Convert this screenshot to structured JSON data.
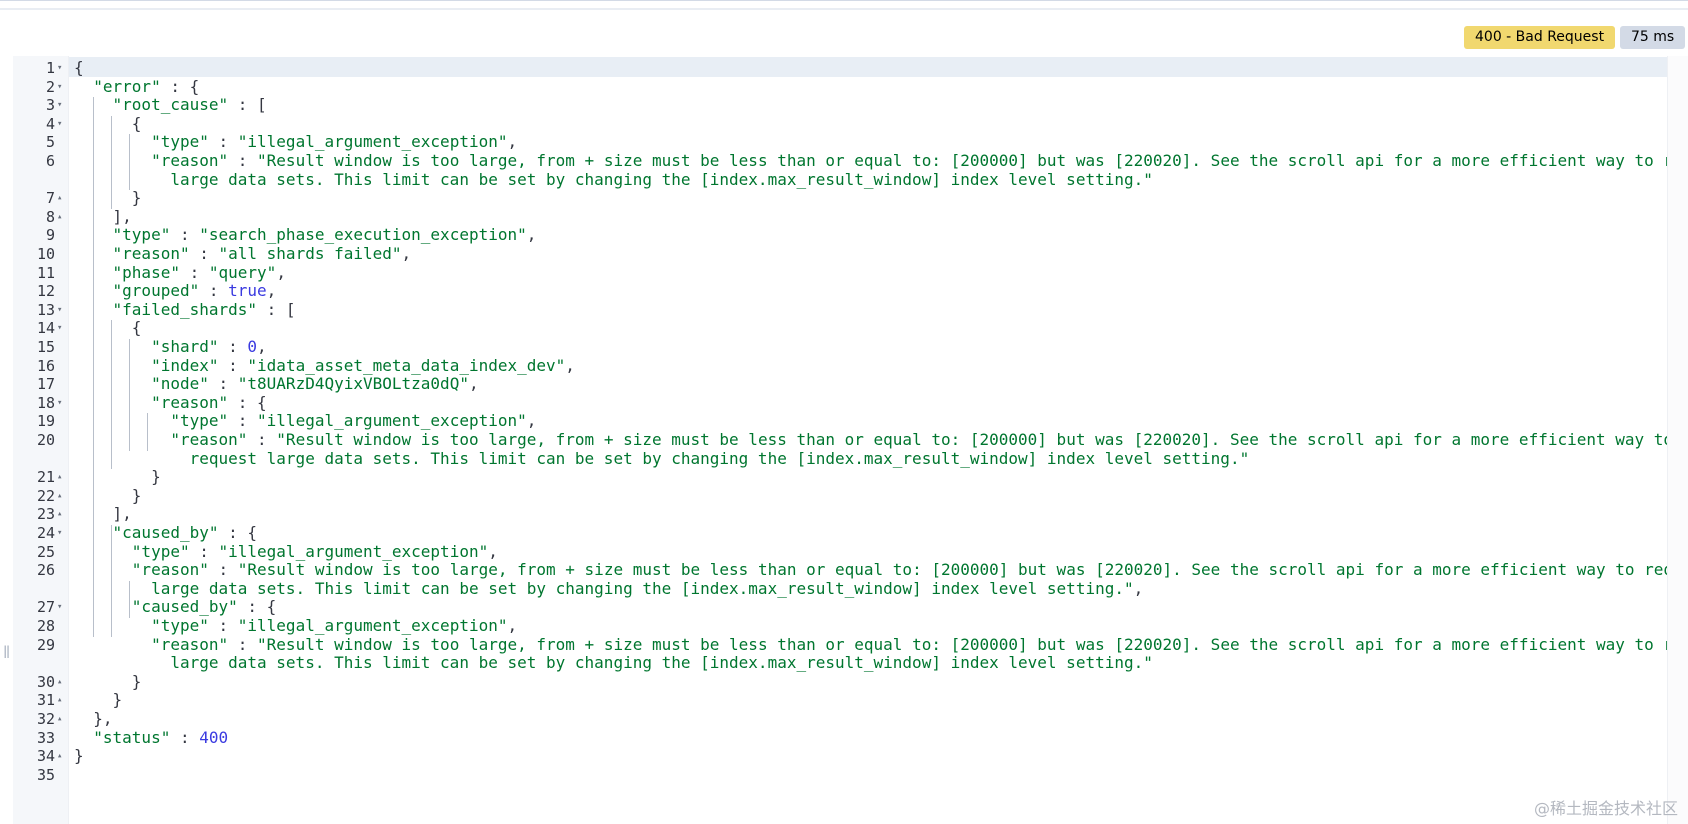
{
  "response": {
    "status_badge": "400 - Bad Request",
    "time_badge": "75 ms"
  },
  "editor": {
    "lines": [
      {
        "n": "1",
        "fold": "▾",
        "segments": [
          {
            "t": "{",
            "c": "punct"
          }
        ]
      },
      {
        "n": "2",
        "fold": "▾",
        "segments": [
          {
            "t": "  ",
            "c": "punct"
          },
          {
            "t": "\"error\"",
            "c": "key"
          },
          {
            "t": " : {",
            "c": "punct"
          }
        ]
      },
      {
        "n": "3",
        "fold": "▾",
        "segments": [
          {
            "t": "    ",
            "c": "punct"
          },
          {
            "t": "\"root_cause\"",
            "c": "key"
          },
          {
            "t": " : [",
            "c": "punct"
          }
        ]
      },
      {
        "n": "4",
        "fold": "▾",
        "segments": [
          {
            "t": "      {",
            "c": "punct"
          }
        ]
      },
      {
        "n": "5",
        "fold": "",
        "segments": [
          {
            "t": "        ",
            "c": "punct"
          },
          {
            "t": "\"type\"",
            "c": "key"
          },
          {
            "t": " : ",
            "c": "punct"
          },
          {
            "t": "\"illegal_argument_exception\"",
            "c": "str"
          },
          {
            "t": ",",
            "c": "punct"
          }
        ]
      },
      {
        "n": "6",
        "fold": "",
        "segments": [
          {
            "t": "        ",
            "c": "punct"
          },
          {
            "t": "\"reason\"",
            "c": "key"
          },
          {
            "t": " : ",
            "c": "punct"
          },
          {
            "t": "\"Result window is too large, from + size must be less than or equal to: [200000] but was [220020]. See the scroll api for a more efficient way to request",
            "c": "str"
          }
        ]
      },
      {
        "n": "",
        "fold": "",
        "segments": [
          {
            "t": "          ",
            "c": "punct"
          },
          {
            "t": "large data sets. This limit can be set by changing the [index.max_result_window] index level setting.\"",
            "c": "str"
          }
        ]
      },
      {
        "n": "7",
        "fold": "▴",
        "segments": [
          {
            "t": "      }",
            "c": "punct"
          }
        ]
      },
      {
        "n": "8",
        "fold": "▴",
        "segments": [
          {
            "t": "    ],",
            "c": "punct"
          }
        ]
      },
      {
        "n": "9",
        "fold": "",
        "segments": [
          {
            "t": "    ",
            "c": "punct"
          },
          {
            "t": "\"type\"",
            "c": "key"
          },
          {
            "t": " : ",
            "c": "punct"
          },
          {
            "t": "\"search_phase_execution_exception\"",
            "c": "str"
          },
          {
            "t": ",",
            "c": "punct"
          }
        ]
      },
      {
        "n": "10",
        "fold": "",
        "segments": [
          {
            "t": "    ",
            "c": "punct"
          },
          {
            "t": "\"reason\"",
            "c": "key"
          },
          {
            "t": " : ",
            "c": "punct"
          },
          {
            "t": "\"all shards failed\"",
            "c": "str"
          },
          {
            "t": ",",
            "c": "punct"
          }
        ]
      },
      {
        "n": "11",
        "fold": "",
        "segments": [
          {
            "t": "    ",
            "c": "punct"
          },
          {
            "t": "\"phase\"",
            "c": "key"
          },
          {
            "t": " : ",
            "c": "punct"
          },
          {
            "t": "\"query\"",
            "c": "str"
          },
          {
            "t": ",",
            "c": "punct"
          }
        ]
      },
      {
        "n": "12",
        "fold": "",
        "segments": [
          {
            "t": "    ",
            "c": "punct"
          },
          {
            "t": "\"grouped\"",
            "c": "key"
          },
          {
            "t": " : ",
            "c": "punct"
          },
          {
            "t": "true",
            "c": "bool"
          },
          {
            "t": ",",
            "c": "punct"
          }
        ]
      },
      {
        "n": "13",
        "fold": "▾",
        "segments": [
          {
            "t": "    ",
            "c": "punct"
          },
          {
            "t": "\"failed_shards\"",
            "c": "key"
          },
          {
            "t": " : [",
            "c": "punct"
          }
        ]
      },
      {
        "n": "14",
        "fold": "▾",
        "segments": [
          {
            "t": "      {",
            "c": "punct"
          }
        ]
      },
      {
        "n": "15",
        "fold": "",
        "segments": [
          {
            "t": "        ",
            "c": "punct"
          },
          {
            "t": "\"shard\"",
            "c": "key"
          },
          {
            "t": " : ",
            "c": "punct"
          },
          {
            "t": "0",
            "c": "num"
          },
          {
            "t": ",",
            "c": "punct"
          }
        ]
      },
      {
        "n": "16",
        "fold": "",
        "segments": [
          {
            "t": "        ",
            "c": "punct"
          },
          {
            "t": "\"index\"",
            "c": "key"
          },
          {
            "t": " : ",
            "c": "punct"
          },
          {
            "t": "\"idata_asset_meta_data_index_dev\"",
            "c": "str"
          },
          {
            "t": ",",
            "c": "punct"
          }
        ]
      },
      {
        "n": "17",
        "fold": "",
        "segments": [
          {
            "t": "        ",
            "c": "punct"
          },
          {
            "t": "\"node\"",
            "c": "key"
          },
          {
            "t": " : ",
            "c": "punct"
          },
          {
            "t": "\"t8UARzD4QyixVBOLtza0dQ\"",
            "c": "str"
          },
          {
            "t": ",",
            "c": "punct"
          }
        ]
      },
      {
        "n": "18",
        "fold": "▾",
        "segments": [
          {
            "t": "        ",
            "c": "punct"
          },
          {
            "t": "\"reason\"",
            "c": "key"
          },
          {
            "t": " : {",
            "c": "punct"
          }
        ]
      },
      {
        "n": "19",
        "fold": "",
        "segments": [
          {
            "t": "          ",
            "c": "punct"
          },
          {
            "t": "\"type\"",
            "c": "key"
          },
          {
            "t": " : ",
            "c": "punct"
          },
          {
            "t": "\"illegal_argument_exception\"",
            "c": "str"
          },
          {
            "t": ",",
            "c": "punct"
          }
        ]
      },
      {
        "n": "20",
        "fold": "",
        "segments": [
          {
            "t": "          ",
            "c": "punct"
          },
          {
            "t": "\"reason\"",
            "c": "key"
          },
          {
            "t": " : ",
            "c": "punct"
          },
          {
            "t": "\"Result window is too large, from + size must be less than or equal to: [200000] but was [220020]. See the scroll api for a more efficient way to",
            "c": "str"
          }
        ]
      },
      {
        "n": "",
        "fold": "",
        "segments": [
          {
            "t": "            ",
            "c": "punct"
          },
          {
            "t": "request large data sets. This limit can be set by changing the [index.max_result_window] index level setting.\"",
            "c": "str"
          }
        ]
      },
      {
        "n": "21",
        "fold": "▴",
        "segments": [
          {
            "t": "        }",
            "c": "punct"
          }
        ]
      },
      {
        "n": "22",
        "fold": "▴",
        "segments": [
          {
            "t": "      }",
            "c": "punct"
          }
        ]
      },
      {
        "n": "23",
        "fold": "▴",
        "segments": [
          {
            "t": "    ],",
            "c": "punct"
          }
        ]
      },
      {
        "n": "24",
        "fold": "▾",
        "segments": [
          {
            "t": "    ",
            "c": "punct"
          },
          {
            "t": "\"caused_by\"",
            "c": "key"
          },
          {
            "t": " : {",
            "c": "punct"
          }
        ]
      },
      {
        "n": "25",
        "fold": "",
        "segments": [
          {
            "t": "      ",
            "c": "punct"
          },
          {
            "t": "\"type\"",
            "c": "key"
          },
          {
            "t": " : ",
            "c": "punct"
          },
          {
            "t": "\"illegal_argument_exception\"",
            "c": "str"
          },
          {
            "t": ",",
            "c": "punct"
          }
        ]
      },
      {
        "n": "26",
        "fold": "",
        "segments": [
          {
            "t": "      ",
            "c": "punct"
          },
          {
            "t": "\"reason\"",
            "c": "key"
          },
          {
            "t": " : ",
            "c": "punct"
          },
          {
            "t": "\"Result window is too large, from + size must be less than or equal to: [200000] but was [220020]. See the scroll api for a more efficient way to request",
            "c": "str"
          }
        ]
      },
      {
        "n": "",
        "fold": "",
        "segments": [
          {
            "t": "        ",
            "c": "punct"
          },
          {
            "t": "large data sets. This limit can be set by changing the [index.max_result_window] index level setting.\"",
            "c": "str"
          },
          {
            "t": ",",
            "c": "punct"
          }
        ]
      },
      {
        "n": "27",
        "fold": "▾",
        "segments": [
          {
            "t": "      ",
            "c": "punct"
          },
          {
            "t": "\"caused_by\"",
            "c": "key"
          },
          {
            "t": " : {",
            "c": "punct"
          }
        ]
      },
      {
        "n": "28",
        "fold": "",
        "segments": [
          {
            "t": "        ",
            "c": "punct"
          },
          {
            "t": "\"type\"",
            "c": "key"
          },
          {
            "t": " : ",
            "c": "punct"
          },
          {
            "t": "\"illegal_argument_exception\"",
            "c": "str"
          },
          {
            "t": ",",
            "c": "punct"
          }
        ]
      },
      {
        "n": "29",
        "fold": "",
        "segments": [
          {
            "t": "        ",
            "c": "punct"
          },
          {
            "t": "\"reason\"",
            "c": "key"
          },
          {
            "t": " : ",
            "c": "punct"
          },
          {
            "t": "\"Result window is too large, from + size must be less than or equal to: [200000] but was [220020]. See the scroll api for a more efficient way to request",
            "c": "str"
          }
        ]
      },
      {
        "n": "",
        "fold": "",
        "segments": [
          {
            "t": "          ",
            "c": "punct"
          },
          {
            "t": "large data sets. This limit can be set by changing the [index.max_result_window] index level setting.\"",
            "c": "str"
          }
        ]
      },
      {
        "n": "30",
        "fold": "▴",
        "segments": [
          {
            "t": "      }",
            "c": "punct"
          }
        ]
      },
      {
        "n": "31",
        "fold": "▴",
        "segments": [
          {
            "t": "    }",
            "c": "punct"
          }
        ]
      },
      {
        "n": "32",
        "fold": "▴",
        "segments": [
          {
            "t": "  },",
            "c": "punct"
          }
        ]
      },
      {
        "n": "33",
        "fold": "",
        "segments": [
          {
            "t": "  ",
            "c": "punct"
          },
          {
            "t": "\"status\"",
            "c": "key"
          },
          {
            "t": " : ",
            "c": "punct"
          },
          {
            "t": "400",
            "c": "num"
          }
        ]
      },
      {
        "n": "34",
        "fold": "▴",
        "segments": [
          {
            "t": "}",
            "c": "punct"
          }
        ]
      },
      {
        "n": "35",
        "fold": "",
        "segments": []
      }
    ]
  },
  "watermark": "@稀土掘金技术社区"
}
